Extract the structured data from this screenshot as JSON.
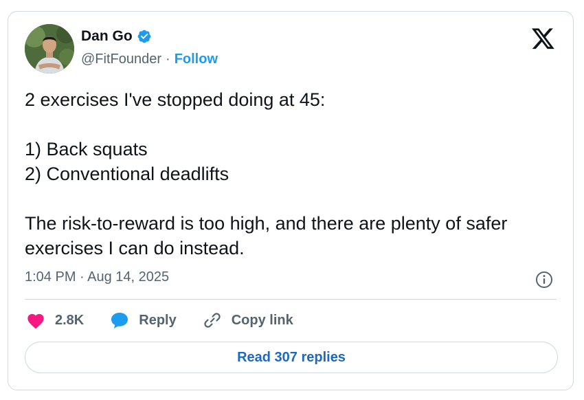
{
  "author": {
    "display_name": "Dan Go",
    "handle": "@FitFounder",
    "separator": "·",
    "follow_label": "Follow"
  },
  "tweet": {
    "line1": "2 exercises I've stopped doing at 45:",
    "line2": "1) Back squats",
    "line3": "2) Conventional deadlifts",
    "line4": "The risk-to-reward is too high, and there are plenty of safer exercises I can do instead.",
    "timestamp": "1:04 PM · Aug 14, 2025"
  },
  "actions": {
    "likes": "2.8K",
    "reply_label": "Reply",
    "copy_link_label": "Copy link"
  },
  "read_replies_label": "Read 307 replies",
  "icons": {
    "verified": "verified-badge-icon",
    "x_logo": "x-logo-icon",
    "info": "info-icon",
    "heart": "heart-icon",
    "reply": "reply-bubble-icon",
    "link": "link-icon"
  },
  "colors": {
    "accent": "#1d9bf0",
    "heart": "#f91880",
    "muted": "#536471",
    "border": "#cfd9de"
  }
}
